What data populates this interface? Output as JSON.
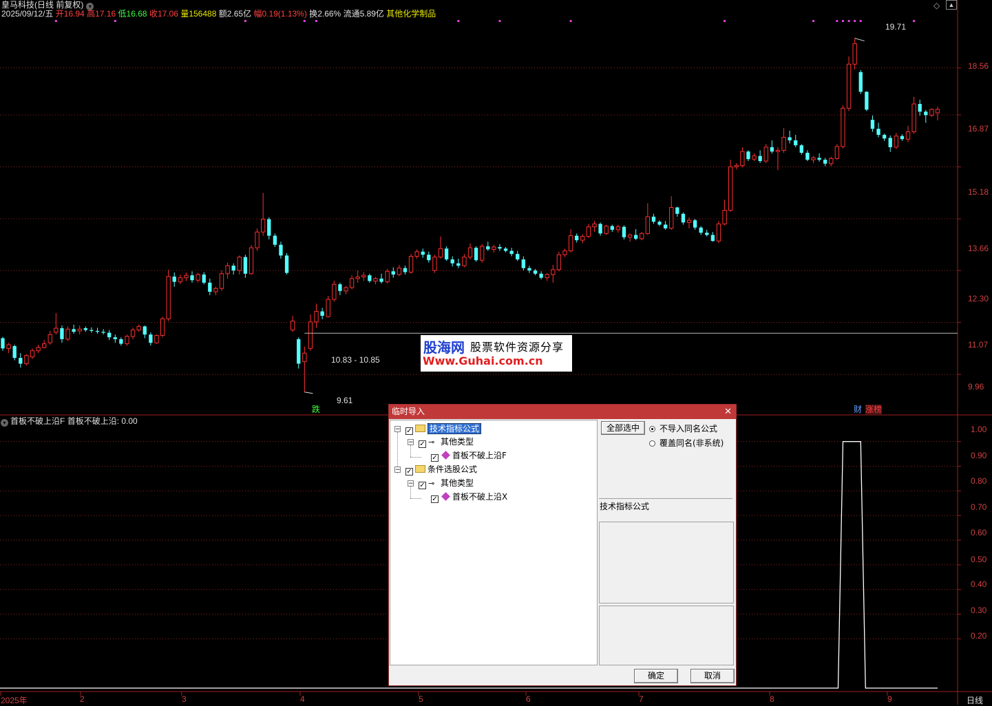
{
  "header": {
    "stock_title": "皇马科技(日线 前复权)",
    "date": "2025/09/12/五",
    "open_label": "开",
    "open": "16.94",
    "high_label": "高",
    "high": "17.16",
    "low_label": "低",
    "low": "16.68",
    "close_label": "收",
    "close": "17.06",
    "volume_label": "量",
    "volume": "156488",
    "amount_label": "额",
    "amount": "2.65亿",
    "change_label": "幅",
    "change": "0.19(1.13%)",
    "turnover_label": "换",
    "turnover": "2.66%",
    "float_label": "流通",
    "float": "5.89亿",
    "sector": "其他化学制品"
  },
  "price_axis": [
    "18.56",
    "16.87",
    "15.18",
    "13.66",
    "12.30",
    "11.07",
    "9.96"
  ],
  "price_annotations": {
    "high_marker": "19.71",
    "low_marker": "9.61",
    "range_label": "10.83 - 10.85"
  },
  "markers": {
    "drop": "跌",
    "finance": "财",
    "limit_up": "涨榜"
  },
  "indicator": {
    "name": "首板不破上沿F",
    "value_label": "首板不破上沿: 0.00",
    "axis": [
      "1.00",
      "0.90",
      "0.80",
      "0.70",
      "0.60",
      "0.50",
      "0.40",
      "0.30",
      "0.20"
    ]
  },
  "x_axis": [
    "2025年",
    "2",
    "3",
    "4",
    "5",
    "6",
    "7",
    "8",
    "9"
  ],
  "period_label": "日线",
  "watermark": {
    "brand": "股海网",
    "slogan": "股票软件资源分享",
    "url": "Www.Guhai.com.cn"
  },
  "dialog": {
    "title": "临时导入",
    "tree": [
      {
        "label": "技术指标公式",
        "children": [
          {
            "label": "其他类型",
            "children": [
              {
                "label": "首板不破上沿F"
              }
            ]
          }
        ]
      },
      {
        "label": "条件选股公式",
        "children": [
          {
            "label": "其他类型",
            "children": [
              {
                "label": "首板不破上沿X"
              }
            ]
          }
        ]
      }
    ],
    "select_all": "全部选中",
    "option_skip": "不导入同名公式",
    "option_overwrite": "覆盖同名(非系统)",
    "info_label": "技术指标公式",
    "ok": "确定",
    "cancel": "取消"
  },
  "colors": {
    "up": "#ff3030",
    "down": "#54ffff",
    "grid": "#a02020",
    "signal": "#ffffff"
  },
  "chart_data": {
    "type": "candlestick",
    "ylim": [
      9.5,
      20.2
    ],
    "indicator_ylim": [
      0,
      1.05
    ],
    "ohlc": [
      [
        10.72,
        10.75,
        10.45,
        10.5
      ],
      [
        10.5,
        10.62,
        10.4,
        10.58
      ],
      [
        10.55,
        10.58,
        10.25,
        10.3
      ],
      [
        10.3,
        10.4,
        10.1,
        10.18
      ],
      [
        10.18,
        10.38,
        10.14,
        10.35
      ],
      [
        10.32,
        10.5,
        10.28,
        10.45
      ],
      [
        10.45,
        10.58,
        10.4,
        10.52
      ],
      [
        10.52,
        10.68,
        10.5,
        10.6
      ],
      [
        10.62,
        10.88,
        10.58,
        10.8
      ],
      [
        10.85,
        11.28,
        10.8,
        10.94
      ],
      [
        10.94,
        11.0,
        10.62,
        10.7
      ],
      [
        10.7,
        10.98,
        10.66,
        10.92
      ],
      [
        10.92,
        11.02,
        10.82,
        10.86
      ],
      [
        10.88,
        11.0,
        10.8,
        10.92
      ],
      [
        10.94,
        10.98,
        10.86,
        10.9
      ],
      [
        10.9,
        10.96,
        10.84,
        10.88
      ],
      [
        10.88,
        10.95,
        10.82,
        10.86
      ],
      [
        10.86,
        10.92,
        10.8,
        10.84
      ],
      [
        10.84,
        10.9,
        10.68,
        10.74
      ],
      [
        10.74,
        10.8,
        10.62,
        10.7
      ],
      [
        10.7,
        10.74,
        10.56,
        10.6
      ],
      [
        10.6,
        10.8,
        10.56,
        10.76
      ],
      [
        10.76,
        10.95,
        10.7,
        10.9
      ],
      [
        10.9,
        11.02,
        10.86,
        10.98
      ],
      [
        10.98,
        11.0,
        10.72,
        10.8
      ],
      [
        10.8,
        10.85,
        10.56,
        10.62
      ],
      [
        10.62,
        10.8,
        10.6,
        10.78
      ],
      [
        10.78,
        11.2,
        10.74,
        11.15
      ],
      [
        11.15,
        12.32,
        11.1,
        12.15
      ],
      [
        12.15,
        12.25,
        11.9,
        12.02
      ],
      [
        12.02,
        12.2,
        11.96,
        12.12
      ],
      [
        12.12,
        12.25,
        12.04,
        12.18
      ],
      [
        12.18,
        12.28,
        12.0,
        12.06
      ],
      [
        12.06,
        12.24,
        12.0,
        12.2
      ],
      [
        12.2,
        12.26,
        11.96,
        12.0
      ],
      [
        12.0,
        12.1,
        11.7,
        11.78
      ],
      [
        11.78,
        11.9,
        11.7,
        11.86
      ],
      [
        11.86,
        12.3,
        11.8,
        12.22
      ],
      [
        12.22,
        12.5,
        12.1,
        12.42
      ],
      [
        12.42,
        12.48,
        12.2,
        12.3
      ],
      [
        12.3,
        12.68,
        12.2,
        12.64
      ],
      [
        12.64,
        12.7,
        12.12,
        12.22
      ],
      [
        12.22,
        12.95,
        12.2,
        12.88
      ],
      [
        12.88,
        13.4,
        12.8,
        13.3
      ],
      [
        13.3,
        14.4,
        13.2,
        13.65
      ],
      [
        13.65,
        13.7,
        13.1,
        13.2
      ],
      [
        13.2,
        13.26,
        12.9,
        12.96
      ],
      [
        12.96,
        13.04,
        12.6,
        12.68
      ],
      [
        12.68,
        12.74,
        12.2,
        12.24
      ],
      [
        10.9,
        11.22,
        10.86,
        11.1
      ],
      [
        10.7,
        10.74,
        10.08,
        10.18
      ],
      [
        10.22,
        10.54,
        9.61,
        10.4
      ],
      [
        10.5,
        11.25,
        10.45,
        11.08
      ],
      [
        11.08,
        11.5,
        10.95,
        11.32
      ],
      [
        11.32,
        11.4,
        11.14,
        11.22
      ],
      [
        11.2,
        11.68,
        11.18,
        11.6
      ],
      [
        11.6,
        12.05,
        11.55,
        11.96
      ],
      [
        11.96,
        12.0,
        11.7,
        11.8
      ],
      [
        11.8,
        11.92,
        11.72,
        11.88
      ],
      [
        11.88,
        12.18,
        11.84,
        12.1
      ],
      [
        12.1,
        12.3,
        12.0,
        12.14
      ],
      [
        12.14,
        12.26,
        12.04,
        12.18
      ],
      [
        12.18,
        12.22,
        12.0,
        12.04
      ],
      [
        12.04,
        12.14,
        11.96,
        12.1
      ],
      [
        12.1,
        12.22,
        11.98,
        12.02
      ],
      [
        12.02,
        12.34,
        11.98,
        12.28
      ],
      [
        12.28,
        12.38,
        12.12,
        12.2
      ],
      [
        12.2,
        12.44,
        12.16,
        12.36
      ],
      [
        12.36,
        12.42,
        12.2,
        12.26
      ],
      [
        12.26,
        12.72,
        12.22,
        12.66
      ],
      [
        12.66,
        12.84,
        12.6,
        12.78
      ],
      [
        12.78,
        12.86,
        12.62,
        12.7
      ],
      [
        12.7,
        12.78,
        12.5,
        12.56
      ],
      [
        12.3,
        12.7,
        12.24,
        12.64
      ],
      [
        12.64,
        13.18,
        12.6,
        12.86
      ],
      [
        12.86,
        12.92,
        12.54,
        12.58
      ],
      [
        12.58,
        12.66,
        12.4,
        12.48
      ],
      [
        12.48,
        12.6,
        12.36,
        12.42
      ],
      [
        12.42,
        12.72,
        12.38,
        12.64
      ],
      [
        12.64,
        13.0,
        12.58,
        12.88
      ],
      [
        12.88,
        12.92,
        12.52,
        12.56
      ],
      [
        12.56,
        12.98,
        12.5,
        12.92
      ],
      [
        12.92,
        13.04,
        12.8,
        12.84
      ],
      [
        12.84,
        12.96,
        12.76,
        12.9
      ],
      [
        12.9,
        12.98,
        12.8,
        12.86
      ],
      [
        12.86,
        12.9,
        12.76,
        12.8
      ],
      [
        12.8,
        12.88,
        12.66,
        12.72
      ],
      [
        12.72,
        12.8,
        12.54,
        12.58
      ],
      [
        12.58,
        12.66,
        12.3,
        12.36
      ],
      [
        12.36,
        12.42,
        12.24,
        12.3
      ],
      [
        12.3,
        12.34,
        12.18,
        12.22
      ],
      [
        12.22,
        12.28,
        12.08,
        12.12
      ],
      [
        12.12,
        12.24,
        12.04,
        12.2
      ],
      [
        12.2,
        12.44,
        12.0,
        12.32
      ],
      [
        12.32,
        12.78,
        12.28,
        12.7
      ],
      [
        12.7,
        12.86,
        12.64,
        12.8
      ],
      [
        12.8,
        13.38,
        12.76,
        13.2
      ],
      [
        13.2,
        13.26,
        13.02,
        13.08
      ],
      [
        13.08,
        13.24,
        13.0,
        13.18
      ],
      [
        13.18,
        13.52,
        13.14,
        13.44
      ],
      [
        13.44,
        13.6,
        13.3,
        13.52
      ],
      [
        13.52,
        13.56,
        13.2,
        13.26
      ],
      [
        13.26,
        13.5,
        13.22,
        13.46
      ],
      [
        13.46,
        13.5,
        13.3,
        13.36
      ],
      [
        13.36,
        13.5,
        13.28,
        13.44
      ],
      [
        13.44,
        13.48,
        13.1,
        13.16
      ],
      [
        13.16,
        13.26,
        13.04,
        13.22
      ],
      [
        13.22,
        13.38,
        13.08,
        13.12
      ],
      [
        13.12,
        13.3,
        13.08,
        13.26
      ],
      [
        13.26,
        14.1,
        13.22,
        13.72
      ],
      [
        13.72,
        13.8,
        13.52,
        13.58
      ],
      [
        13.58,
        13.62,
        13.46,
        13.5
      ],
      [
        13.5,
        13.6,
        13.36,
        13.4
      ],
      [
        13.4,
        14.3,
        13.36,
        13.98
      ],
      [
        13.98,
        14.0,
        13.72,
        13.8
      ],
      [
        13.8,
        13.84,
        13.5,
        13.56
      ],
      [
        13.56,
        13.7,
        13.4,
        13.62
      ],
      [
        13.62,
        13.66,
        13.36,
        13.42
      ],
      [
        13.42,
        13.46,
        13.22,
        13.28
      ],
      [
        13.28,
        13.36,
        13.18,
        13.22
      ],
      [
        13.22,
        13.3,
        13.04,
        13.06
      ],
      [
        13.06,
        13.6,
        13.0,
        13.52
      ],
      [
        13.52,
        14.2,
        13.48,
        13.9
      ],
      [
        13.9,
        15.4,
        13.86,
        15.18
      ],
      [
        15.18,
        15.3,
        15.1,
        15.22
      ],
      [
        15.22,
        15.8,
        15.16,
        15.66
      ],
      [
        15.66,
        15.7,
        15.36,
        15.42
      ],
      [
        15.42,
        15.6,
        15.36,
        15.52
      ],
      [
        15.52,
        15.7,
        15.3,
        15.36
      ],
      [
        15.36,
        15.9,
        15.3,
        15.8
      ],
      [
        15.8,
        16.02,
        15.6,
        15.66
      ],
      [
        15.66,
        15.8,
        15.08,
        15.7
      ],
      [
        15.7,
        16.42,
        15.62,
        16.12
      ],
      [
        16.12,
        16.34,
        15.92,
        16.02
      ],
      [
        16.02,
        16.2,
        15.8,
        15.86
      ],
      [
        15.86,
        15.9,
        15.56,
        15.62
      ],
      [
        15.62,
        15.7,
        15.36,
        15.4
      ],
      [
        15.4,
        15.52,
        15.3,
        15.46
      ],
      [
        15.46,
        15.6,
        15.34,
        15.4
      ],
      [
        15.4,
        15.46,
        15.2,
        15.28
      ],
      [
        15.28,
        15.5,
        15.2,
        15.44
      ],
      [
        15.44,
        15.9,
        15.4,
        15.82
      ],
      [
        15.82,
        17.2,
        15.76,
        17.1
      ],
      [
        17.1,
        19.0,
        17.0,
        18.7
      ],
      [
        18.7,
        19.71,
        18.5,
        19.5
      ],
      [
        18.4,
        18.48,
        17.6,
        17.68
      ],
      [
        17.68,
        17.7,
        17.0,
        17.05
      ],
      [
        16.7,
        16.85,
        16.3,
        16.4
      ],
      [
        16.4,
        16.6,
        16.12,
        16.2
      ],
      [
        16.2,
        16.24,
        16.0,
        16.08
      ],
      [
        16.1,
        16.18,
        15.65,
        15.8
      ],
      [
        15.8,
        16.26,
        15.74,
        16.16
      ],
      [
        16.16,
        16.22,
        16.0,
        16.06
      ],
      [
        16.06,
        16.5,
        15.96,
        16.3
      ],
      [
        16.3,
        17.5,
        16.24,
        17.25
      ],
      [
        17.25,
        17.4,
        16.84,
        16.98
      ],
      [
        16.98,
        17.04,
        16.6,
        16.86
      ],
      [
        16.86,
        17.1,
        16.8,
        17.06
      ],
      [
        16.94,
        17.16,
        16.68,
        17.06
      ]
    ],
    "indicator_signal": {
      "start_index": 142,
      "end_index": 145,
      "value": 1.0
    }
  }
}
